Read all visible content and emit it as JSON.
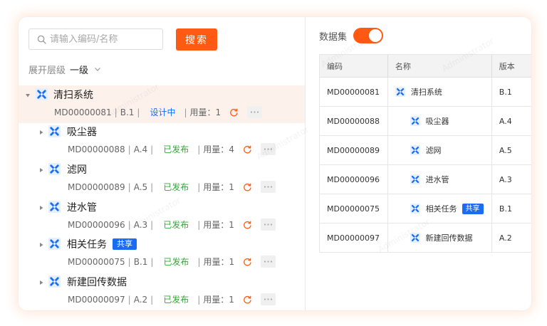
{
  "search": {
    "placeholder": "请输入编码/名称",
    "button_label": "搜索"
  },
  "expand": {
    "label": "展开层级",
    "value": "一级"
  },
  "tree": [
    {
      "title": "清扫系统",
      "code": "MD00000081",
      "version": "B.1",
      "status": "设计中",
      "status_type": "design",
      "usage": "用量：1",
      "badge": ""
    },
    {
      "title": "吸尘器",
      "code": "MD00000088",
      "version": "A.4",
      "status": "已发布",
      "status_type": "published",
      "usage": "用量：4",
      "badge": ""
    },
    {
      "title": "滤网",
      "code": "MD00000089",
      "version": "A.5",
      "status": "已发布",
      "status_type": "published",
      "usage": "用量：1",
      "badge": ""
    },
    {
      "title": "进水管",
      "code": "MD00000096",
      "version": "A.3",
      "status": "已发布",
      "status_type": "published",
      "usage": "用量：1",
      "badge": ""
    },
    {
      "title": "相关任务",
      "code": "MD00000075",
      "version": "B.1",
      "status": "已发布",
      "status_type": "published",
      "usage": "用量：1",
      "badge": "共享"
    },
    {
      "title": "新建回传数据",
      "code": "MD00000097",
      "version": "A.2",
      "status": "已发布",
      "status_type": "published",
      "usage": "用量：1",
      "badge": ""
    }
  ],
  "dataset": {
    "label": "数据集",
    "toggle_on": true
  },
  "table": {
    "headers": [
      "编码",
      "名称",
      "版本"
    ],
    "rows": [
      {
        "code": "MD00000081",
        "name": "清扫系统",
        "version": "B.1",
        "badge": ""
      },
      {
        "code": "MD00000088",
        "name": "吸尘器",
        "version": "A.4",
        "badge": ""
      },
      {
        "code": "MD00000089",
        "name": "滤网",
        "version": "A.5",
        "badge": ""
      },
      {
        "code": "MD00000096",
        "name": "进水管",
        "version": "A.3",
        "badge": ""
      },
      {
        "code": "MD00000075",
        "name": "相关任务",
        "version": "B.1",
        "badge": "共享"
      },
      {
        "code": "MD00000097",
        "name": "新建回传数据",
        "version": "A.2",
        "badge": ""
      }
    ]
  },
  "watermark": "Administrator",
  "colors": {
    "accent": "#ff5a14",
    "status_design": "#1a6cf2",
    "status_published": "#33a83a",
    "badge": "#1a6cf2",
    "selected_row": "#fdf1ec"
  }
}
